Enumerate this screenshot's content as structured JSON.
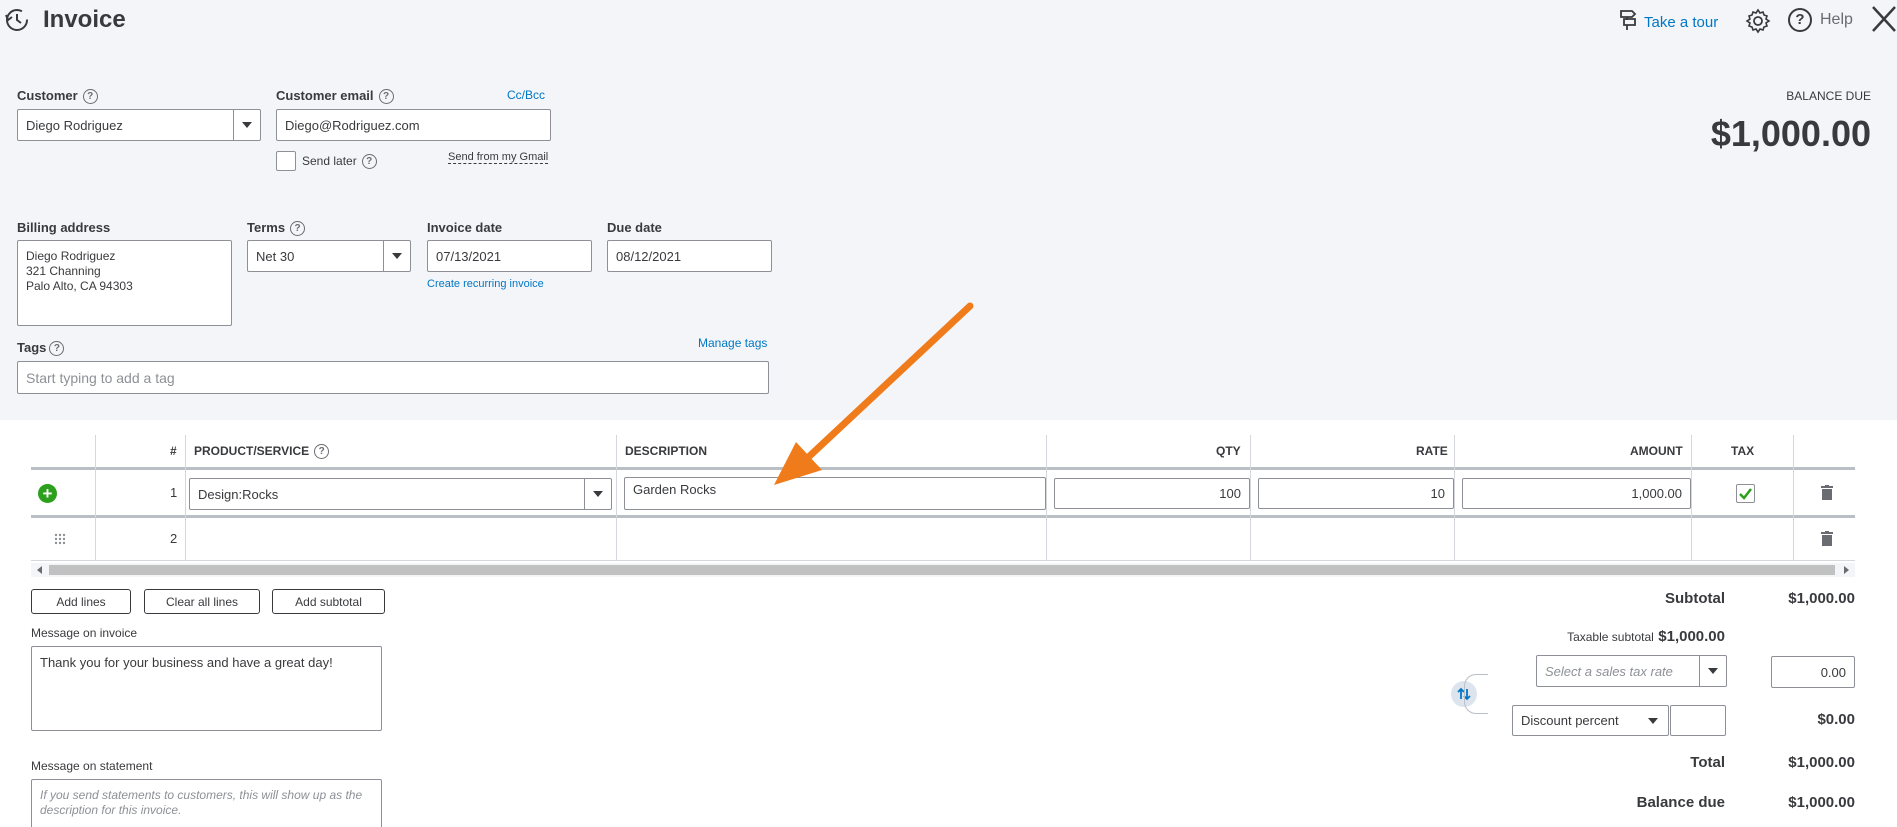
{
  "header": {
    "title": "Invoice",
    "take_tour": "Take a tour",
    "help": "Help"
  },
  "customer": {
    "label": "Customer",
    "value": "Diego Rodriguez"
  },
  "email": {
    "label": "Customer email",
    "value": "Diego@Rodriguez.com",
    "cc_bcc": "Cc/Bcc",
    "send_later": "Send later",
    "send_gmail": "Send from my Gmail"
  },
  "balance": {
    "label": "BALANCE DUE",
    "amount": "$1,000.00"
  },
  "billing": {
    "label": "Billing address",
    "line1": "Diego Rodriguez",
    "line2": "321 Channing",
    "line3": "Palo Alto, CA  94303"
  },
  "terms": {
    "label": "Terms",
    "value": "Net 30"
  },
  "invoice_date": {
    "label": "Invoice date",
    "value": "07/13/2021",
    "recurring": "Create recurring invoice"
  },
  "due_date": {
    "label": "Due date",
    "value": "08/12/2021"
  },
  "tags": {
    "label": "Tags",
    "manage": "Manage tags",
    "placeholder": "Start typing to add a tag"
  },
  "table": {
    "headers": {
      "num": "#",
      "product": "PRODUCT/SERVICE",
      "description": "DESCRIPTION",
      "qty": "QTY",
      "rate": "RATE",
      "amount": "AMOUNT",
      "tax": "TAX"
    },
    "rows": [
      {
        "num": "1",
        "product": "Design:Rocks",
        "description": "Garden Rocks",
        "qty": "100",
        "rate": "10",
        "amount": "1,000.00"
      },
      {
        "num": "2"
      }
    ]
  },
  "buttons": {
    "add_lines": "Add lines",
    "clear_all": "Clear all lines",
    "add_subtotal": "Add subtotal"
  },
  "message_invoice": {
    "label": "Message on invoice",
    "value": "Thank you for your business and have a great day!"
  },
  "message_statement": {
    "label": "Message on statement",
    "placeholder": "If you send statements to customers, this will show up as the description for this invoice."
  },
  "totals": {
    "subtotal_label": "Subtotal",
    "subtotal_value": "$1,000.00",
    "taxable_label": "Taxable subtotal",
    "taxable_value": "$1,000.00",
    "tax_rate_placeholder": "Select a sales tax rate",
    "tax_value": "0.00",
    "discount_label": "Discount percent",
    "discount_value": "$0.00",
    "total_label": "Total",
    "total_value": "$1,000.00",
    "balance_label": "Balance due",
    "balance_value": "$1,000.00"
  },
  "colors": {
    "accent": "#0077c5",
    "green": "#2ca01c",
    "arrow": "#f07b1a"
  }
}
